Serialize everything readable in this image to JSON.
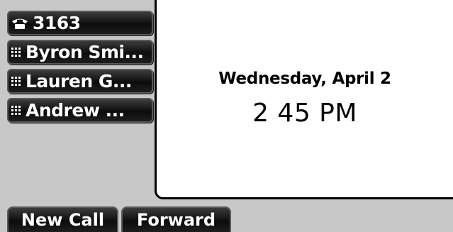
{
  "line_keys": [
    {
      "icon": "phone-handset-icon",
      "label": "3163"
    },
    {
      "icon": "speed-dial-grid-icon",
      "label": "Byron Smi..."
    },
    {
      "icon": "speed-dial-grid-icon",
      "label": "Lauren G..."
    },
    {
      "icon": "speed-dial-grid-icon",
      "label": "Andrew ..."
    }
  ],
  "idle_screen": {
    "date": "Wednesday, April 2",
    "time": "2 45 PM"
  },
  "softkeys": {
    "new_call": "New Call",
    "forward": "Forward"
  }
}
